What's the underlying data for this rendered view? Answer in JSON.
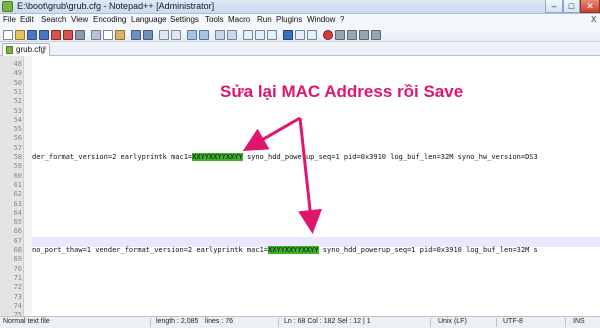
{
  "window": {
    "title": "E:\\boot\\grub\\grub.cfg - Notepad++ [Administrator]",
    "minimize_glyph": "–",
    "maximize_glyph": "□",
    "close_glyph": "✕"
  },
  "menu": [
    "File",
    "Edit",
    "Search",
    "View",
    "Encoding",
    "Language",
    "Settings",
    "Tools",
    "Macro",
    "Run",
    "Plugins",
    "Window",
    "?"
  ],
  "menu_close_glyph": "X",
  "tabs": [
    {
      "label": "grub.cfg",
      "close_glyph": "x"
    }
  ],
  "editor": {
    "line_numbers": [
      "48",
      "49",
      "50",
      "51",
      "52",
      "53",
      "54",
      "55",
      "56",
      "57",
      "58",
      "59",
      "60",
      "61",
      "62",
      "63",
      "64",
      "65",
      "66",
      "67",
      "68",
      "69",
      "70",
      "71",
      "72",
      "73",
      "74",
      "75",
      "76"
    ],
    "line58": {
      "before": "der_format_version=2 earlyprintk mac1=",
      "mac": "XXYYXXYYXXYY",
      "after": " syno_hdd_powerup_seq=1 pid=0x3910 log_buf_len=32M syno_hw_version=DS3"
    },
    "line68": {
      "before": "no_port_thaw=1 vender_format_version=2 earlyprintk mac1=",
      "mac": "XXYYXXYYXXYY",
      "after": " syno_hdd_powerup_seq=1 pid=0x3910 log_buf_len=32M s"
    }
  },
  "annotation": {
    "text": "Sửa lại MAC Address rồi Save",
    "color": "#e0166e"
  },
  "status": {
    "file_type": "Normal text file",
    "length": "length : 2,085",
    "lines": "lines : 76",
    "position": "Ln : 68   Col : 182   Sel : 12 | 1",
    "eol": "Unix (LF)",
    "encoding": "UTF-8",
    "mode": "INS"
  },
  "colors": {
    "highlight": "#3fae2c",
    "accent": "#e0166e"
  }
}
